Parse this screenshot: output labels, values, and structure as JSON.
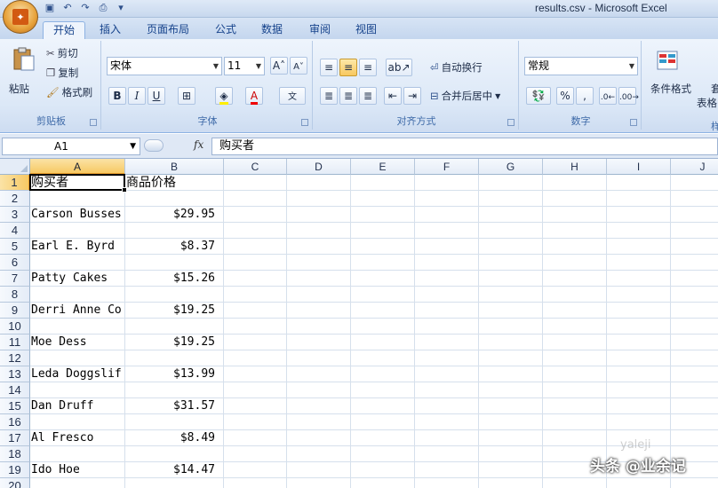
{
  "window": {
    "title": "results.csv - Microsoft Excel"
  },
  "ribbon": {
    "tabs": [
      "开始",
      "插入",
      "页面布局",
      "公式",
      "数据",
      "审阅",
      "视图"
    ],
    "active_tab": "开始",
    "clipboard": {
      "label": "剪贴板",
      "paste": "粘贴",
      "cut": "剪切",
      "copy": "复制",
      "format_painter": "格式刷"
    },
    "font": {
      "label": "字体",
      "name": "宋体",
      "size": "11",
      "bold": "B",
      "italic": "I",
      "underline": "U"
    },
    "alignment": {
      "label": "对齐方式",
      "wrap_text": "自动换行",
      "merge_center": "合并后居中"
    },
    "number": {
      "label": "数字",
      "format": "常规",
      "percent": "%",
      "comma": ","
    },
    "styles": {
      "conditional": "条件格式",
      "partial_1": "套",
      "partial_2": "表格",
      "partial_3": "样"
    }
  },
  "formula_bar": {
    "name_box": "A1",
    "fx": "fx",
    "value": "购买者"
  },
  "sheet": {
    "columns": [
      "A",
      "B",
      "C",
      "D",
      "E",
      "F",
      "G",
      "H",
      "I",
      "J"
    ],
    "selected_column": "A",
    "rows": [
      "1",
      "2",
      "3",
      "4",
      "5",
      "6",
      "7",
      "8",
      "9",
      "10",
      "11",
      "12",
      "13",
      "14",
      "15",
      "16",
      "17",
      "18",
      "19",
      "20"
    ],
    "selected_row": "1",
    "headers": {
      "a": "购买者",
      "b": "商品价格"
    },
    "records": [
      {
        "row": 3,
        "buyer": "Carson Busses",
        "price": "$29.95"
      },
      {
        "row": 5,
        "buyer": "Earl E. Byrd",
        "price": "$8.37"
      },
      {
        "row": 7,
        "buyer": "Patty Cakes",
        "price": "$15.26"
      },
      {
        "row": 9,
        "buyer": "Derri Anne Co",
        "price": "$19.25"
      },
      {
        "row": 11,
        "buyer": "Moe Dess",
        "price": "$19.25"
      },
      {
        "row": 13,
        "buyer": "Leda Doggslif",
        "price": "$13.99"
      },
      {
        "row": 15,
        "buyer": "Dan Druff",
        "price": "$31.57"
      },
      {
        "row": 17,
        "buyer": "Al Fresco",
        "price": "$8.49"
      },
      {
        "row": 19,
        "buyer": "Ido Hoe",
        "price": "$14.47"
      }
    ]
  },
  "watermark": {
    "text": "头条 @业余记",
    "faint": "yaleji"
  },
  "colors": {
    "accent": "#15428b",
    "selection": "#f7c964",
    "grid": "#d6e0ec"
  }
}
